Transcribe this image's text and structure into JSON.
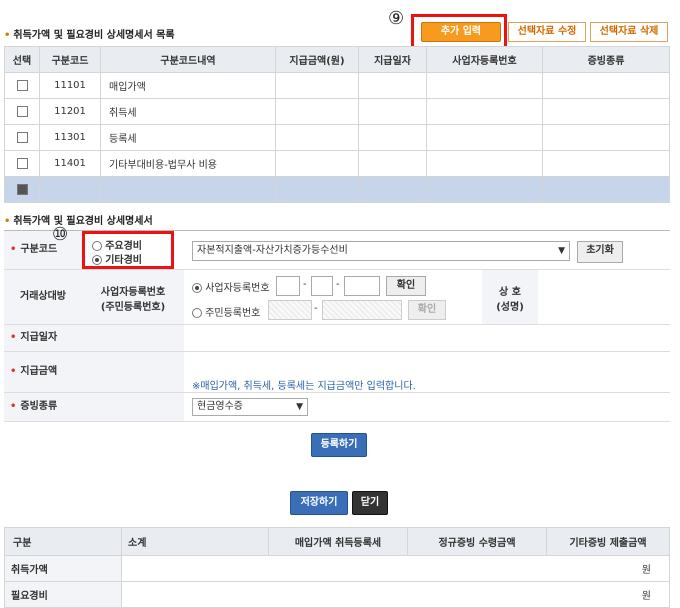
{
  "list_section": {
    "title": "취득가액 및 필요경비 상세명세서 목록",
    "buttons": {
      "add": "추가 입력",
      "edit": "선택자료 수정",
      "delete": "선택자료 삭제"
    },
    "marker": "⑨",
    "columns": [
      "선택",
      "구분코드",
      "구분코드내역",
      "지급금액(원)",
      "지급일자",
      "사업자등록번호",
      "증빙종류"
    ],
    "rows": [
      {
        "checked": false,
        "code": "11101",
        "desc": "매입가액"
      },
      {
        "checked": false,
        "code": "11201",
        "desc": "취득세"
      },
      {
        "checked": false,
        "code": "11301",
        "desc": "등록세"
      },
      {
        "checked": false,
        "code": "11401",
        "desc": "기타부대비용-법무사 비용"
      },
      {
        "checked": true,
        "code": "",
        "desc": ""
      }
    ]
  },
  "detail_section": {
    "title": "취득가액 및 필요경비 상세명세서",
    "marker": "⑩",
    "code_label": "구분코드",
    "radio_major": "주요경비",
    "radio_other": "기타경비",
    "code_select": "자본적지출액-자산가치증가등수선비",
    "reset_button": "초기화",
    "partner_label": "거래상대방",
    "reg_label_1": "사업자등록번호",
    "reg_label_2": "(주민등록번호)",
    "biz_radio": "사업자등록번호",
    "resident_radio": "주민등록번호",
    "confirm_button": "확인",
    "confirm_button_2": "확인",
    "name_label_1": "상 호",
    "name_label_2": "(성명)",
    "pay_date_label": "지급일자",
    "pay_amount_label": "지급금액",
    "note": "※매입가액, 취득세, 등록세는 지급금액만 입력합니다.",
    "proof_label": "증빙종류",
    "proof_select": "현금영수증",
    "register_button": "등록하기"
  },
  "bottom": {
    "save_button": "저장하기",
    "close_button": "닫기",
    "columns": [
      "구분",
      "소계",
      "매입가액 취득등록세",
      "정규증빙 수령금액",
      "기타증빙 제출금액"
    ],
    "rows": [
      {
        "label": "취득가액",
        "unit": "원"
      },
      {
        "label": "필요경비",
        "unit": "원"
      }
    ]
  }
}
